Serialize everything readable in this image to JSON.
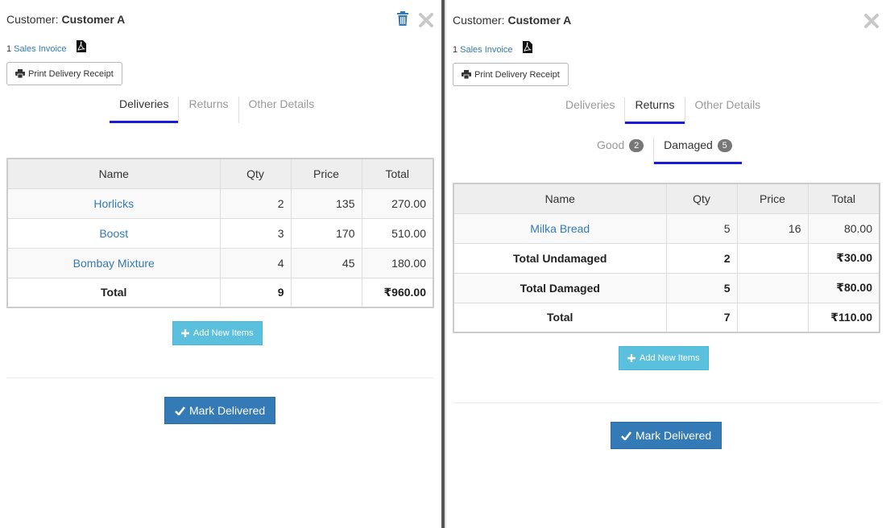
{
  "left": {
    "customer_label": "Customer:",
    "customer_name": "Customer A",
    "invoice_count": "1",
    "invoice_link": "Sales Invoice",
    "print_label": "Print Delivery Receipt",
    "tabs": [
      {
        "label": "Deliveries",
        "active": true
      },
      {
        "label": "Returns",
        "active": false
      },
      {
        "label": "Other Details",
        "active": false
      }
    ],
    "table": {
      "headers": [
        "Name",
        "Qty",
        "Price",
        "Total"
      ],
      "rows": [
        {
          "name": "Horlicks",
          "qty": "2",
          "price": "135",
          "total": "270.00"
        },
        {
          "name": "Boost",
          "qty": "3",
          "price": "170",
          "total": "510.00"
        },
        {
          "name": "Bombay Mixture",
          "qty": "4",
          "price": "45",
          "total": "180.00"
        }
      ],
      "total_row": {
        "label": "Total",
        "qty": "9",
        "price": "",
        "total": "₹960.00"
      }
    },
    "add_label": "Add New Items",
    "deliver_label": "Mark Delivered"
  },
  "right": {
    "customer_label": "Customer:",
    "customer_name": "Customer A",
    "invoice_count": "1",
    "invoice_link": "Sales Invoice",
    "print_label": "Print Delivery Receipt",
    "tabs": [
      {
        "label": "Deliveries",
        "active": false
      },
      {
        "label": "Returns",
        "active": true
      },
      {
        "label": "Other Details",
        "active": false
      }
    ],
    "subtabs": [
      {
        "label": "Good",
        "badge": "2",
        "active": false
      },
      {
        "label": "Damaged",
        "badge": "5",
        "active": true
      }
    ],
    "table": {
      "headers": [
        "Name",
        "Qty",
        "Price",
        "Total"
      ],
      "rows": [
        {
          "name": "Milka Bread",
          "qty": "5",
          "price": "16",
          "total": "80.00"
        }
      ],
      "summary_rows": [
        {
          "label": "Total Undamaged",
          "qty": "2",
          "price": "",
          "total": "₹30.00"
        },
        {
          "label": "Total Damaged",
          "qty": "5",
          "price": "",
          "total": "₹80.00"
        },
        {
          "label": "Total",
          "qty": "7",
          "price": "",
          "total": "₹110.00"
        }
      ]
    },
    "add_label": "Add New Items",
    "deliver_label": "Mark Delivered"
  },
  "colors": {
    "link": "#337ab7",
    "tab_underline": "#1a1ad6",
    "add_button": "#5bc0de",
    "deliver_button": "#337ab7",
    "badge": "#777777"
  },
  "icons": {
    "trash": "trash-icon",
    "close": "close-icon",
    "pdf": "pdf-icon",
    "print": "print-icon",
    "plus": "plus-icon",
    "check": "check-icon"
  }
}
